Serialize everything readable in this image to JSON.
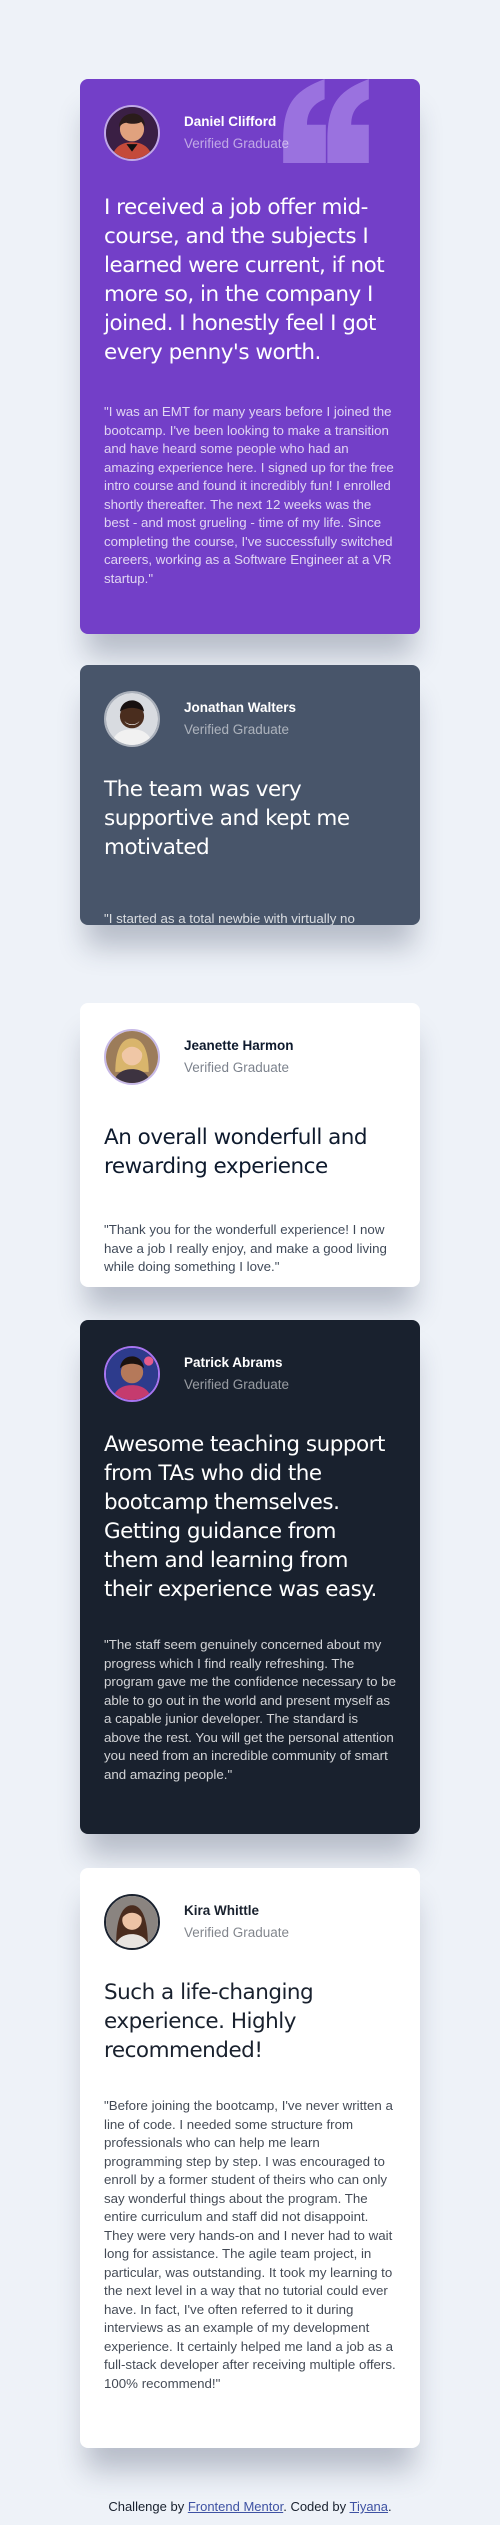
{
  "colors": {
    "page_background": "#eef2f8",
    "card_1": "#733fc8",
    "card_2": "#48556a",
    "card_3": "#ffffff",
    "card_4": "#19212e",
    "card_5": "#ffffff",
    "link": "#3e52a3"
  },
  "testimonials": [
    {
      "name": "Daniel Clifford",
      "role": "Verified Graduate",
      "headline": "I received a job offer mid-course, and the subjects I learned were current, if not more so, in the company I joined. I honestly feel I got every penny's worth.",
      "quote": "\"I was an EMT for many years before I joined the bootcamp. I've been looking to make a transition and have heard some people who had an amazing experience here. I signed up for the free intro course and found it incredibly fun! I enrolled shortly thereafter. The next 12 weeks was the best - and most grueling - time of my life. Since completing the course, I've successfully switched careers, working as a Software Engineer at a VR startup.\"",
      "avatar_icon": "user-photo",
      "decoration_icon": "quotation-mark-icon"
    },
    {
      "name": "Jonathan Walters",
      "role": "Verified Graduate",
      "headline": "The team was very supportive and kept me motivated",
      "quote": "\"I started as a total newbie with virtually no coding skills. I now work as a mobile engineer for a big company. This was one of the best investments I've made in myself.\"",
      "avatar_icon": "user-photo"
    },
    {
      "name": "Jeanette Harmon",
      "role": "Verified Graduate",
      "headline": "An overall wonderfull and rewarding experience",
      "quote": "\"Thank you for the wonderfull experience! I now have a job I really enjoy, and make a good living while doing something I love.\"",
      "avatar_icon": "user-photo"
    },
    {
      "name": "Patrick Abrams",
      "role": "Verified Graduate",
      "headline": "Awesome teaching support from TAs who did the bootcamp themselves. Getting guidance from them and learning from their experience was easy.",
      "quote": "\"The staff seem genuinely concerned about my progress which I find really refreshing. The program gave me the confidence necessary to be able to go out in the world and present myself as a capable junior developer. The standard is above the rest. You will get the personal attention you need from an incredible community of smart and amazing people.\"",
      "avatar_icon": "user-photo"
    },
    {
      "name": "Kira Whittle",
      "role": "Verified Graduate",
      "headline": "Such a life-changing experience. Highly recommended!",
      "quote": "\"Before joining the bootcamp, I've never written a line of code. I needed some structure from professionals who can help me learn programming step by step. I was encouraged to enroll by a former student of theirs who can only say wonderful things about the program. The entire curriculum and staff did not disappoint. They were very hands-on and I never had to wait long for assistance. The agile team project, in particular, was outstanding. It took my learning to the next level in a way that no tutorial could ever have. In fact, I've often referred to it during interviews as an example of my development experience. It certainly helped me land a job as a full-stack developer after receiving multiple offers. 100% recommend!\"",
      "avatar_icon": "user-photo"
    }
  ],
  "attribution": {
    "prefix": "Challenge by ",
    "challenge_link": "Frontend Mentor",
    "middle": ". Coded by ",
    "author_link": "Tiyana",
    "suffix": "."
  }
}
